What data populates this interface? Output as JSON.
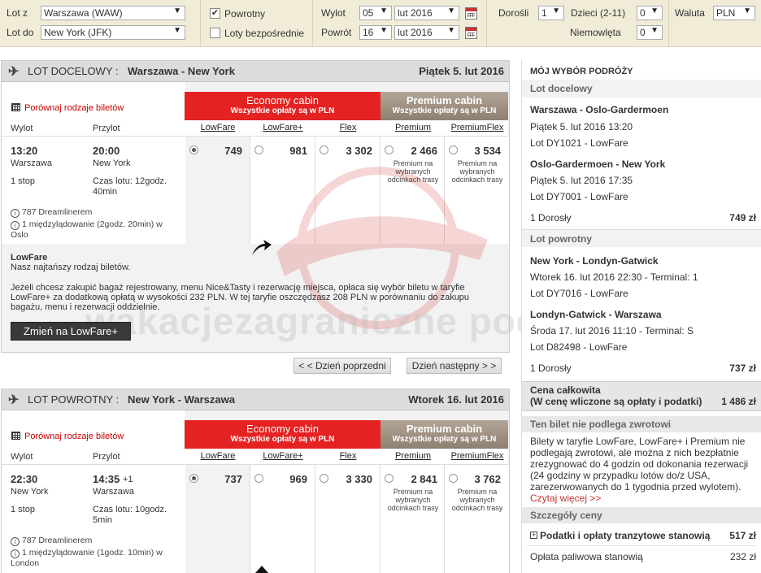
{
  "search": {
    "from_label": "Lot z",
    "from_value": "Warszawa (WAW)",
    "to_label": "Lot do",
    "to_value": "New York (JFK)",
    "return_label": "Powrotny",
    "direct_label": "Loty bezpośrednie",
    "depart_label": "Wylot",
    "depart_day": "05",
    "depart_month": "lut 2016",
    "return_date_label": "Powrót",
    "return_day": "16",
    "return_month": "lut 2016",
    "adults_label": "Dorośli",
    "adults_value": "1",
    "children_label": "Dzieci (2-11)",
    "children_value": "0",
    "infants_label": "Niemowlęta",
    "infants_value": "0",
    "currency_label": "Waluta",
    "currency_value": "PLN"
  },
  "outbound": {
    "header_label": "LOT DOCELOWY :",
    "route": "Warszawa - New York",
    "date": "Piątek 5. lut 2016",
    "compare_link": "Porównaj rodzaje biletów",
    "col_depart": "Wylot",
    "col_arrive": "Przylot",
    "dep_time": "13:20",
    "dep_city": "Warszawa",
    "arr_time": "20:00",
    "arr_city": "New York",
    "stops": "1 stop",
    "duration": "Czas lotu: 12godz. 40min",
    "aircraft": "787 Dreamlinerem",
    "layover": "1 międzylądowanie (2godz. 20min) w Oslo",
    "prices": [
      "749",
      "981",
      "3 302",
      "2 466",
      "3 534"
    ],
    "info_title": "LowFare",
    "info_sub": "Nasz najtańszy rodzaj biletów.",
    "info_text": "Jeżeli chcesz zakupić bagaż rejestrowany, menu Nice&Tasty i rezerwację miejsca, opłaca się wybór biletu w taryfie LowFare+ za dodatkową opłatą w wysokości 232 PLN. W tej taryfie oszczędzasz 208 PLN w porównaniu do zakupu bagażu, menu i rezerwacji oddzielnie.",
    "upgrade_button": "Zmień na LowFare+"
  },
  "cabins": {
    "economy_title": "Economy cabin",
    "economy_sub": "Wszystkie opłaty są w PLN",
    "premium_title": "Premium cabin",
    "premium_sub": "Wszystkie opłaty są w PLN",
    "fares": [
      "LowFare",
      "LowFare+",
      "Flex",
      "Premium",
      "PremiumFlex"
    ],
    "premium_note": "Premium na wybranych odcinkach trasy"
  },
  "nav": {
    "prev_day": "< < Dzień poprzedni",
    "next_day": "Dzień następny > >"
  },
  "inbound": {
    "header_label": "LOT POWROTNY :",
    "route": "New York - Warszawa",
    "date": "Wtorek 16. lut 2016",
    "compare_link": "Porównaj rodzaje biletów",
    "col_depart": "Wylot",
    "col_arrive": "Przylot",
    "dep_time": "22:30",
    "dep_city": "New York",
    "arr_time": "14:35",
    "arr_plus": "+1",
    "arr_city": "Warszawa",
    "stops": "1 stop",
    "duration": "Czas lotu: 10godz. 5min",
    "aircraft": "787 Dreamlinerem",
    "layover": "1 międzylądowanie (1godz. 10min) w London",
    "prices": [
      "737",
      "969",
      "3 330",
      "2 841",
      "3 762"
    ]
  },
  "summary": {
    "title": "MÓJ WYBÓR PODRÓŻY",
    "outbound_heading": "Lot docelowy",
    "seg1_route": "Warszawa - Oslo-Gardermoen",
    "seg1_date": "Piątek 5. lut 2016 13:20",
    "seg1_flight": "Lot DY1021 - LowFare",
    "seg2_route": "Oslo-Gardermoen - New York",
    "seg2_date": "Piątek 5. lut 2016 17:35",
    "seg2_flight": "Lot DY7001 - LowFare",
    "outbound_pax": "1 Dorosły",
    "outbound_price": "749 zł",
    "return_heading": "Lot powrotny",
    "seg3_route": "New York - Londyn-Gatwick",
    "seg3_date": "Wtorek 16. lut 2016 22:30 - Terminal: 1",
    "seg3_flight": "Lot DY7016 - LowFare",
    "seg4_route": "Londyn-Gatwick - Warszawa",
    "seg4_date": "Środa 17. lut 2016 11:10 - Terminal: S",
    "seg4_flight": "Lot D82498 - LowFare",
    "return_pax": "1 Dorosły",
    "return_price": "737 zł",
    "total_label": "Cena całkowita",
    "total_sub": "(W cenę wliczone są opłaty i podatki)",
    "total_price": "1 486 zł",
    "nonrefund_heading": "Ten bilet nie podlega zwrotowi",
    "nonrefund_text": "Bilety w taryfie LowFare, LowFare+ i Premium nie podlegają zwrotowi, ale można z nich bezpłatnie zrezygnować do 4 godzin od dokonania rezerwacji (24 godziny w przypadku lotów do/z USA, zarezerwowanych do 1 tygodnia przed wylotem).",
    "read_more": "Czytaj więcej >>",
    "price_details_heading": "Szczegóły ceny",
    "taxes_label": "Podatki i opłaty tranzytowe stanowią",
    "taxes_value": "517 zł",
    "fuel_label": "Opłata paliwowa stanowią",
    "fuel_value": "232 zł"
  },
  "watermark": "wakacjezagraniczne podroze.com.pl",
  "colors": {
    "economy": "#e42222",
    "premium": "#a09282",
    "accent_red": "#cc0000"
  }
}
